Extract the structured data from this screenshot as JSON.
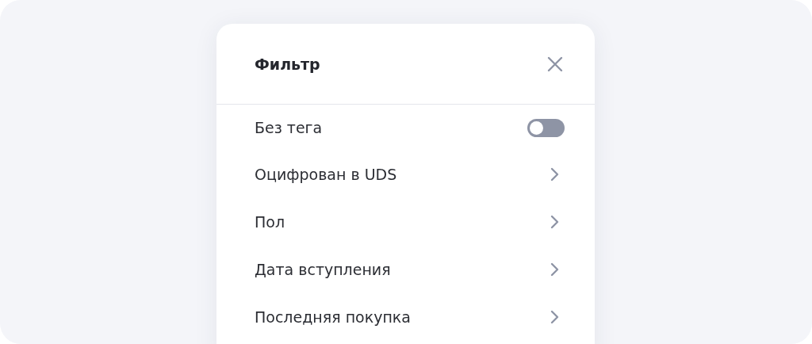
{
  "dialog": {
    "title": "Фильтр",
    "items": [
      {
        "kind": "toggle",
        "label": "Без тега",
        "on": false
      },
      {
        "kind": "link",
        "label": "Оцифрован в UDS"
      },
      {
        "kind": "link",
        "label": "Пол"
      },
      {
        "kind": "link",
        "label": "Дата вступления"
      },
      {
        "kind": "link",
        "label": "Последняя покупка"
      }
    ]
  }
}
